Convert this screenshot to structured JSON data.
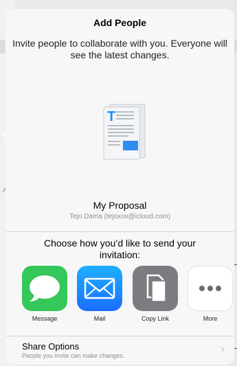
{
  "background": {
    "edge_label": "AM"
  },
  "popover": {
    "title": "Add People",
    "subtitle": "Invite people to collaborate with you. Everyone will see the latest changes.",
    "document": {
      "icon": "pages-document-icon",
      "name": "My Proposal",
      "owner": "Tejo Dama (tejoxox@icloud.com)"
    },
    "choose_prompt": "Choose how you’d like to send your invitation:",
    "apps": [
      {
        "label": "Message",
        "icon": "message-icon",
        "color": "#34c759"
      },
      {
        "label": "Mail",
        "icon": "mail-icon",
        "color": "#1a8cff"
      },
      {
        "label": "Copy Link",
        "icon": "copy-link-icon",
        "color": "#7c7c80"
      },
      {
        "label": "More",
        "icon": "more-icon",
        "color": "#ffffff"
      }
    ],
    "share_options": {
      "title": "Share Options",
      "subtitle": "People you invite can make changes."
    }
  },
  "colors": {
    "accent": "#1a8cff",
    "muted": "#8e8e93"
  }
}
